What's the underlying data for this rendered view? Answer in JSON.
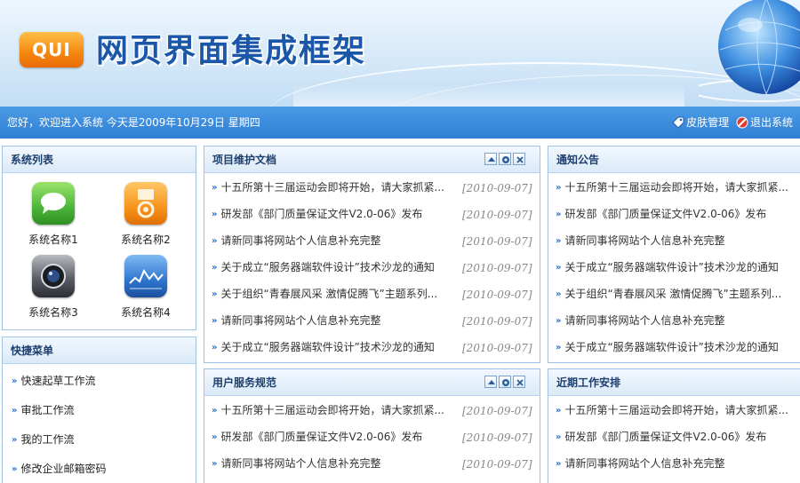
{
  "header": {
    "logo_text": "QUI",
    "title": "网页界面集成框架"
  },
  "status_bar": {
    "greeting": "您好，欢迎进入系统  今天是2009年10月29日  星期四",
    "skin_label": "皮肤管理",
    "logout_label": "退出系统"
  },
  "systems_panel": {
    "title": "系统列表",
    "items": [
      {
        "label": "系统名称1",
        "icon": "message-app-icon"
      },
      {
        "label": "系统名称2",
        "icon": "music-player-app-icon"
      },
      {
        "label": "系统名称3",
        "icon": "camera-app-icon"
      },
      {
        "label": "系统名称4",
        "icon": "stocks-app-icon"
      }
    ]
  },
  "quick_menu": {
    "title": "快捷菜单",
    "items": [
      "快速起草工作流",
      "审批工作流",
      "我的工作流",
      "修改企业邮箱密码"
    ]
  },
  "project_docs": {
    "title": "项目维护文档",
    "rows": [
      {
        "text": "十五所第十三届运动会即将开始，请大家抓紧...",
        "date": "[2010-09-07]"
      },
      {
        "text": "研发部《部门质量保证文件V2.0-06》发布",
        "date": "[2010-09-07]"
      },
      {
        "text": "请新同事将网站个人信息补充完整",
        "date": "[2010-09-07]"
      },
      {
        "text": "关于成立“服务器端软件设计”技术沙龙的通知",
        "date": "[2010-09-07]"
      },
      {
        "text": "关于组织“青春展风采 激情促腾飞”主题系列...",
        "date": "[2010-09-07]"
      },
      {
        "text": "请新同事将网站个人信息补充完整",
        "date": "[2010-09-07]"
      },
      {
        "text": "关于成立“服务器端软件设计”技术沙龙的通知",
        "date": "[2010-09-07]"
      }
    ]
  },
  "notices": {
    "title": "通知公告",
    "rows": [
      "十五所第十三届运动会即将开始，请大家抓紧...",
      "研发部《部门质量保证文件V2.0-06》发布",
      "请新同事将网站个人信息补充完整",
      "关于成立“服务器端软件设计”技术沙龙的通知",
      "关于组织“青春展风采 激情促腾飞”主题系列...",
      "请新同事将网站个人信息补充完整",
      "关于成立“服务器端软件设计”技术沙龙的通知"
    ]
  },
  "user_service": {
    "title": "用户服务规范",
    "rows": [
      {
        "text": "十五所第十三届运动会即将开始，请大家抓紧...",
        "date": "[2010-09-07]"
      },
      {
        "text": "研发部《部门质量保证文件V2.0-06》发布",
        "date": "[2010-09-07]"
      },
      {
        "text": "请新同事将网站个人信息补充完整",
        "date": "[2010-09-07]"
      }
    ]
  },
  "recent_work": {
    "title": "近期工作安排",
    "rows": [
      "十五所第十三届运动会即将开始，请大家抓紧...",
      "研发部《部门质量保证文件V2.0-06》发布",
      "请新同事将网站个人信息补充完整"
    ]
  },
  "colors": {
    "statusbar": "#2f7fd4",
    "panel_border": "#9fc3e7",
    "title_blue": "#1b57a8",
    "logo_orange": "#f68a12"
  }
}
